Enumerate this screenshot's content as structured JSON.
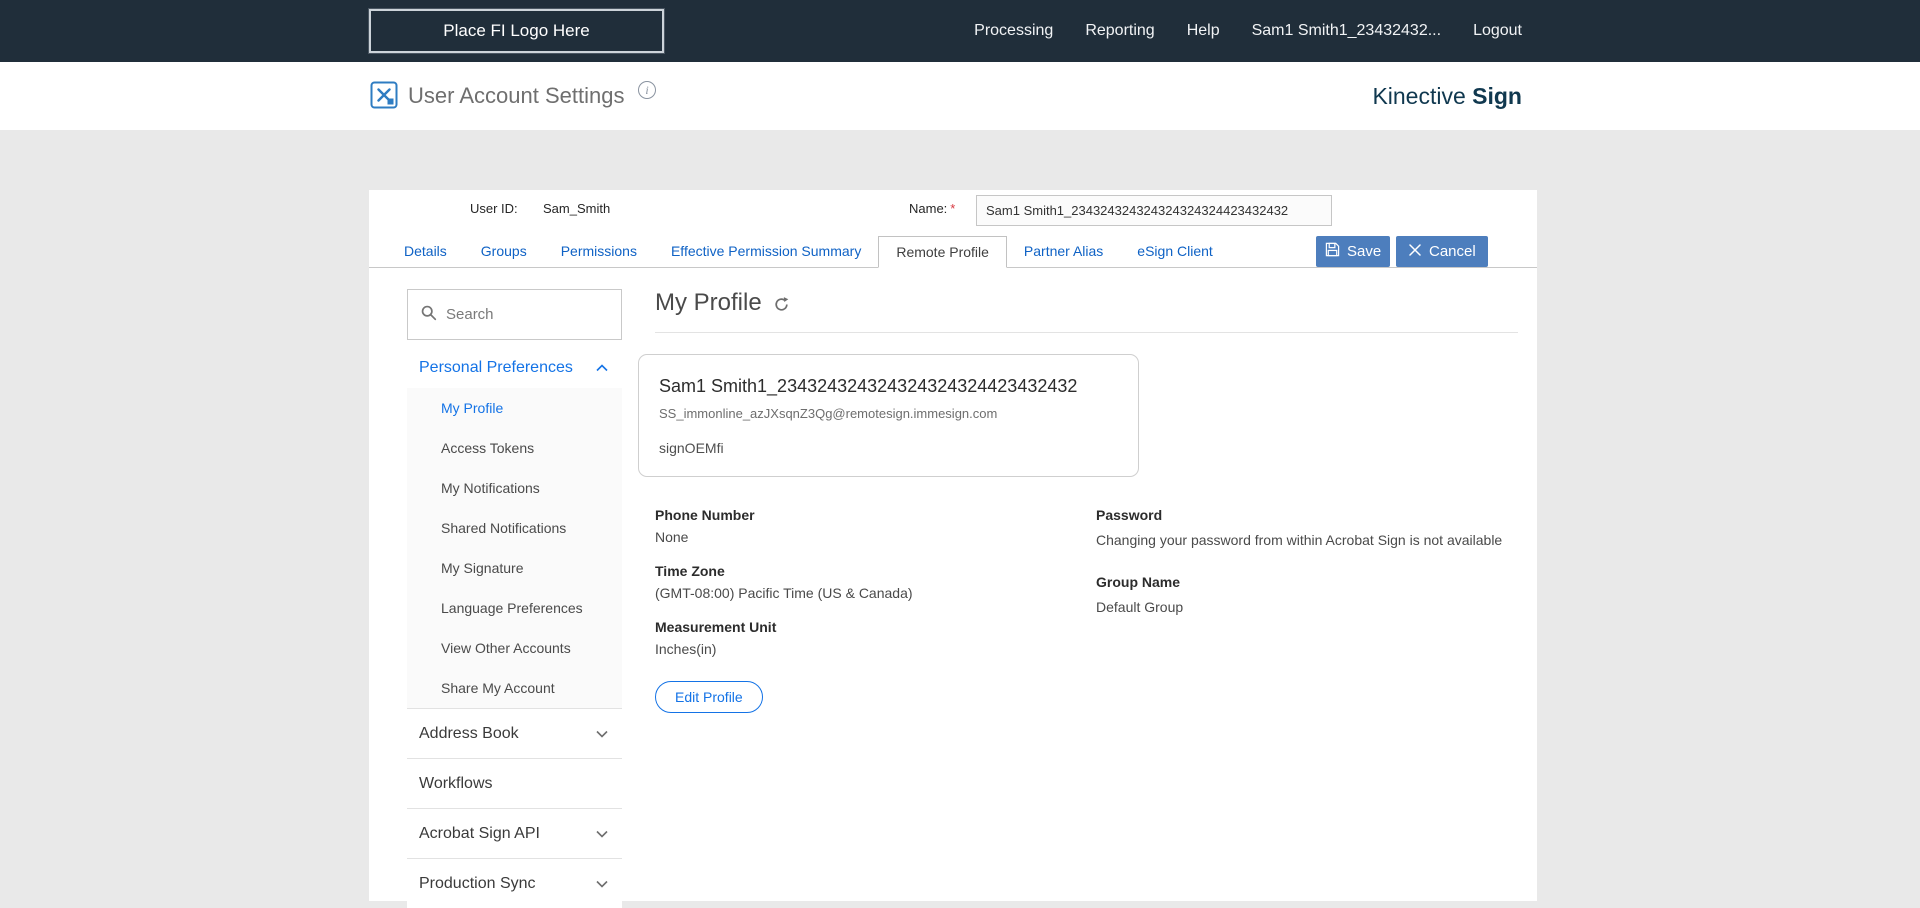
{
  "topbar": {
    "logo_placeholder": "Place FI Logo Here",
    "nav": {
      "processing": "Processing",
      "reporting": "Reporting",
      "help": "Help",
      "user": "Sam1 Smith1_23432432...",
      "logout": "Logout"
    }
  },
  "header": {
    "title": "User Account Settings",
    "brand_regular": "Kinective",
    "brand_bold": "Sign"
  },
  "account_bar": {
    "user_id_label": "User ID:",
    "user_id_value": "Sam_Smith",
    "name_label": "Name:",
    "required_mark": "*",
    "name_value": "Sam1 Smith1_234324324324324324324423432432"
  },
  "tabs": {
    "items": [
      "Details",
      "Groups",
      "Permissions",
      "Effective Permission Summary",
      "Remote Profile",
      "Partner Alias",
      "eSign Client"
    ],
    "active": "Remote Profile"
  },
  "actions": {
    "save_label": "Save",
    "cancel_label": "Cancel"
  },
  "sidebar": {
    "search_placeholder": "Search",
    "personal_preferences_label": "Personal Preferences",
    "personal_preferences_items": [
      "My Profile",
      "Access Tokens",
      "My Notifications",
      "Shared Notifications",
      "My Signature",
      "Language Preferences",
      "View Other Accounts",
      "Share My Account"
    ],
    "active_item": "My Profile",
    "collapsed_sections": [
      "Address Book",
      "Workflows",
      "Acrobat Sign API",
      "Production Sync"
    ]
  },
  "profile": {
    "heading": "My Profile",
    "card": {
      "name": "Sam1 Smith1_234324324324324324324423432432",
      "email": "SS_immonline_azJXsqnZ3Qg@remotesign.immesign.com",
      "company": "signOEMfi"
    },
    "phone_label": "Phone Number",
    "phone_value": "None",
    "timezone_label": "Time Zone",
    "timezone_value": "(GMT-08:00) Pacific Time (US & Canada)",
    "unit_label": "Measurement Unit",
    "unit_value": "Inches(in)",
    "password_label": "Password",
    "password_note": "Changing your password from within Acrobat Sign is not available",
    "group_label": "Group Name",
    "group_value": "Default Group",
    "edit_button": "Edit Profile"
  },
  "colors": {
    "topbar_bg": "#202e3a",
    "accent_blue": "#1473e6",
    "tab_link_blue": "#0f62c5",
    "button_blue": "#4d7ebd",
    "brand_navy": "#10384f",
    "required_red": "#d7373f"
  }
}
